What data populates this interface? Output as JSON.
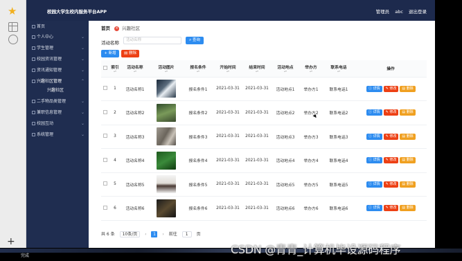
{
  "app": {
    "title": "校园大学生校内服务平台APP",
    "user_label": "管理员",
    "username": "abc",
    "logout_label": "退出登录"
  },
  "sidebar": {
    "items": [
      {
        "label": "首页"
      },
      {
        "label": "个人中心"
      },
      {
        "label": "学生管理"
      },
      {
        "label": "校园资讯管理"
      },
      {
        "label": "资讯通知管理"
      },
      {
        "label": "兴趣社区管理"
      },
      {
        "label": "兴趣社区"
      },
      {
        "label": "二手物品类管理"
      },
      {
        "label": "兼职信息管理"
      },
      {
        "label": "校园互动"
      },
      {
        "label": "系统管理"
      }
    ]
  },
  "breadcrumb": {
    "home": "首页",
    "current_tab": "兴趣社区"
  },
  "search": {
    "label": "活动名称",
    "placeholder": "活动名称",
    "button": "查询"
  },
  "actions": {
    "add": "+ 新增",
    "delete": "删除"
  },
  "table": {
    "columns": [
      "索引",
      "活动名称",
      "活动图片",
      "报名条件",
      "开始时间",
      "结束时间",
      "活动地点",
      "举办方",
      "联系电话",
      "操作"
    ],
    "rows": [
      {
        "index": "1",
        "name": "活动名称1",
        "image": "t1",
        "condition": "报名条件1",
        "start": "2021-03-31",
        "end": "2021-03-31",
        "place": "活动地点1",
        "host": "举办方1",
        "phone": "联系电话1"
      },
      {
        "index": "2",
        "name": "活动名称2",
        "image": "t2",
        "condition": "报名条件2",
        "start": "2021-03-31",
        "end": "2021-03-31",
        "place": "活动地点2",
        "host": "举办方2",
        "phone": "联系电话2"
      },
      {
        "index": "3",
        "name": "活动名称3",
        "image": "t3",
        "condition": "报名条件3",
        "start": "2021-03-31",
        "end": "2021-03-31",
        "place": "活动地点3",
        "host": "举办方3",
        "phone": "联系电话3"
      },
      {
        "index": "4",
        "name": "活动名称4",
        "image": "t4",
        "condition": "报名条件4",
        "start": "2021-03-31",
        "end": "2021-03-31",
        "place": "活动地点4",
        "host": "举办方4",
        "phone": "联系电话4"
      },
      {
        "index": "5",
        "name": "活动名称5",
        "image": "t5",
        "condition": "报名条件5",
        "start": "2021-03-31",
        "end": "2021-03-31",
        "place": "活动地点5",
        "host": "举办方5",
        "phone": "联系电话5"
      },
      {
        "index": "6",
        "name": "活动名称6",
        "image": "t6",
        "condition": "报名条件6",
        "start": "2021-03-31",
        "end": "2021-03-31",
        "place": "活动地点6",
        "host": "举办方6",
        "phone": "联系电话6"
      }
    ],
    "row_actions": {
      "detail": "详情",
      "edit": "修改",
      "delete": "删除"
    }
  },
  "pagination": {
    "total": "共 6 条",
    "page_size": "10条/页",
    "current_page": "1",
    "goto_label": "前往",
    "goto_value": "1",
    "page_suffix": "页"
  },
  "status_bar": {
    "text": "完成"
  },
  "watermark": "CSDN @青青_计算机毕设源码程序",
  "colors": {
    "topbar": "#1d2a4d",
    "primary": "#2d8cf0",
    "danger": "#ed4014",
    "warning": "#f0a020"
  }
}
